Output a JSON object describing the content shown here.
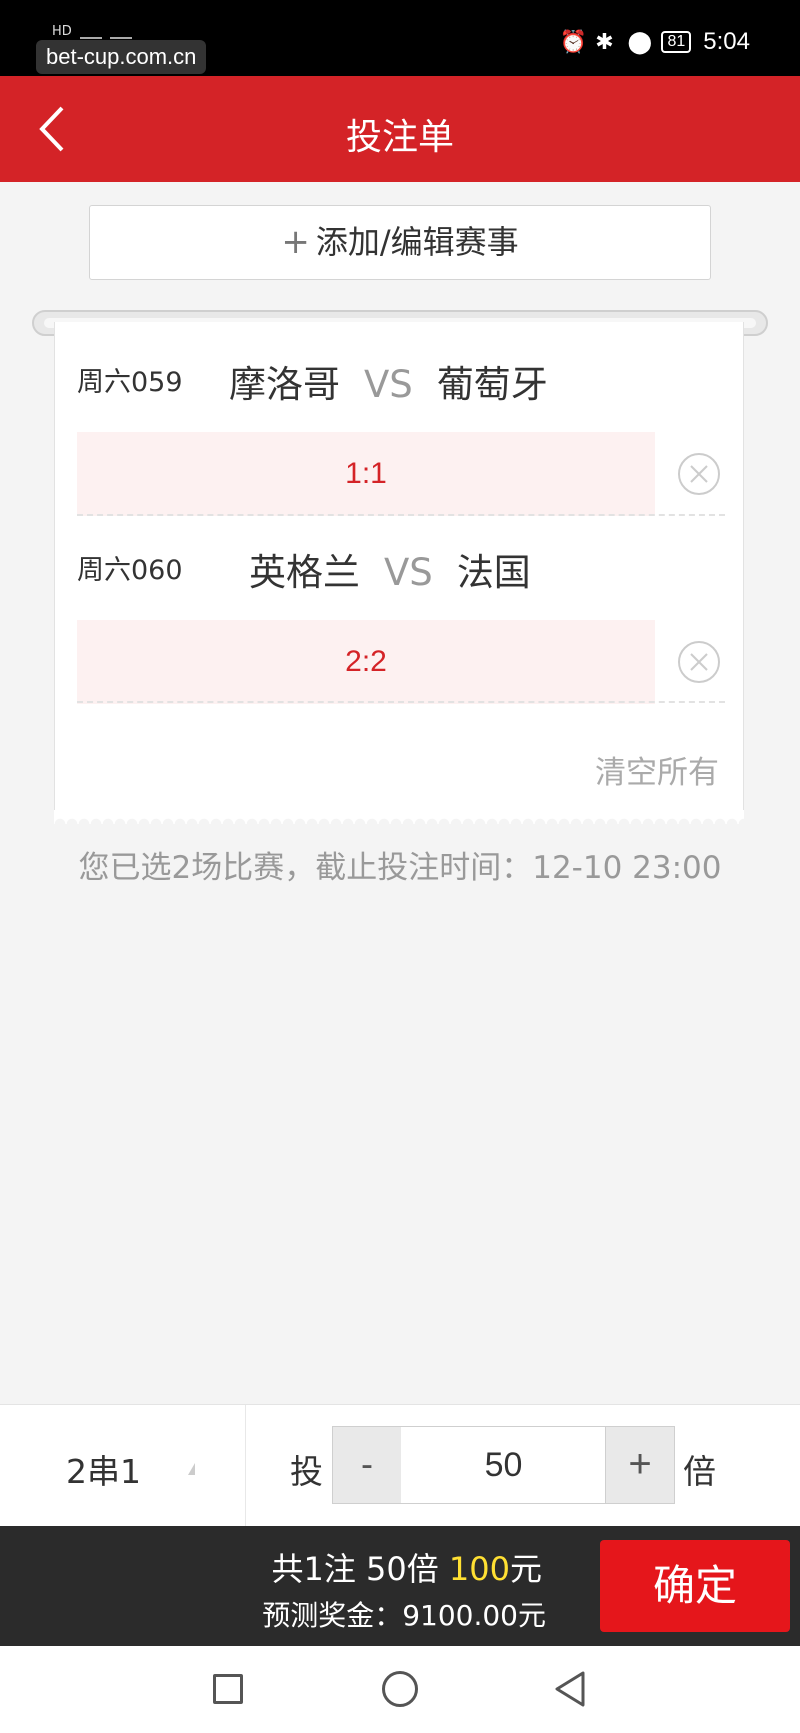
{
  "status_bar": {
    "left": "HD",
    "watermark": "bet-cup.com.cn",
    "battery": "81",
    "time": "5:04"
  },
  "header": {
    "title": "投注单"
  },
  "add_button": {
    "plus": "+",
    "label": "添加/编辑赛事"
  },
  "matches": [
    {
      "day": "周六059",
      "home": "摩洛哥",
      "vs": "VS",
      "away": "葡萄牙",
      "pick": "1:1"
    },
    {
      "day": "周六060",
      "home": "英格兰",
      "vs": "VS",
      "away": "法国",
      "pick": "2:2"
    }
  ],
  "clear_all": "清空所有",
  "notice": "您已选2场比赛，截止投注时间：12-10 23:00",
  "bet_bar": {
    "combo": "2串1",
    "tou": "投",
    "minus": "-",
    "multiple": "50",
    "plus": "+",
    "bei": "倍"
  },
  "summary": {
    "line1_prefix": "共1注 50倍 ",
    "amount": "100",
    "line1_suffix": "元",
    "prize": "预测奖金：9100.00元",
    "confirm": "确定"
  },
  "colors": {
    "brand_red": "#d42327",
    "amount_yellow": "#ffe033",
    "pick_bg": "#fdf1f1"
  }
}
